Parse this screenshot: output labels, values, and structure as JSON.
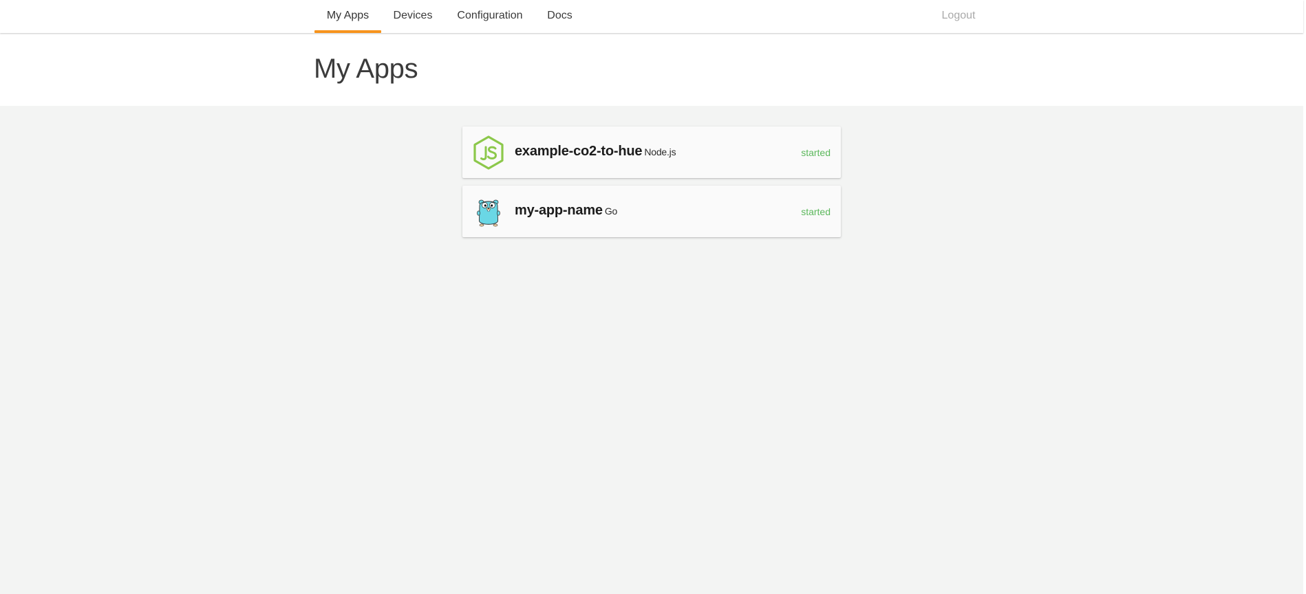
{
  "nav": {
    "items": [
      {
        "label": "My Apps",
        "active": true
      },
      {
        "label": "Devices",
        "active": false
      },
      {
        "label": "Configuration",
        "active": false
      },
      {
        "label": "Docs",
        "active": false
      }
    ],
    "logout_label": "Logout",
    "accent_color": "#f7941d"
  },
  "page": {
    "title": "My Apps"
  },
  "apps": [
    {
      "name": "example-co2-to-hue",
      "runtime": "Node.js",
      "status": "started",
      "icon": "nodejs-icon"
    },
    {
      "name": "my-app-name",
      "runtime": "Go",
      "status": "started",
      "icon": "go-gopher-icon"
    }
  ],
  "colors": {
    "status_started": "#5cb85c",
    "nodejs_green": "#8cc84b",
    "gopher_blue": "#6ad7e5"
  }
}
